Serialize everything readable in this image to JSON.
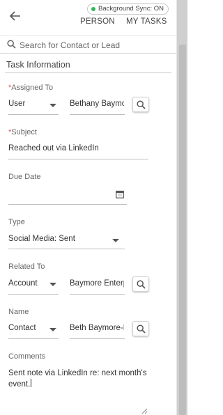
{
  "header": {
    "back_icon": "arrow-left-icon",
    "sync_status": "Background Sync: ON",
    "sync_color": "#2eb85c",
    "tabs": [
      {
        "label": "PERSON"
      },
      {
        "label": "MY TASKS"
      }
    ]
  },
  "search": {
    "icon": "search-icon",
    "placeholder": "Search for Contact or Lead",
    "value": ""
  },
  "section": {
    "title": "Task Information"
  },
  "form": {
    "assigned_to": {
      "required_mark": "*",
      "label": "Assigned To",
      "type_value": "User",
      "lookup_value": "Bethany Baymore"
    },
    "subject": {
      "required_mark": "*",
      "label": "Subject",
      "value": "Reached out via LinkedIn"
    },
    "due_date": {
      "label": "Due Date",
      "value": "",
      "icon": "calendar-icon"
    },
    "type": {
      "label": "Type",
      "value": "Social Media: Sent"
    },
    "related_to": {
      "label": "Related To",
      "type_value": "Account",
      "lookup_value": "Baymore Enterprises"
    },
    "name": {
      "label": "Name",
      "type_value": "Contact",
      "lookup_value": "Beth Baymore-Davis"
    },
    "comments": {
      "label": "Comments",
      "value": "Sent note via LinkedIn re: next month's event."
    }
  },
  "colors": {
    "required": "#d9534f",
    "scrollbar_track": "#cfcfcf"
  }
}
